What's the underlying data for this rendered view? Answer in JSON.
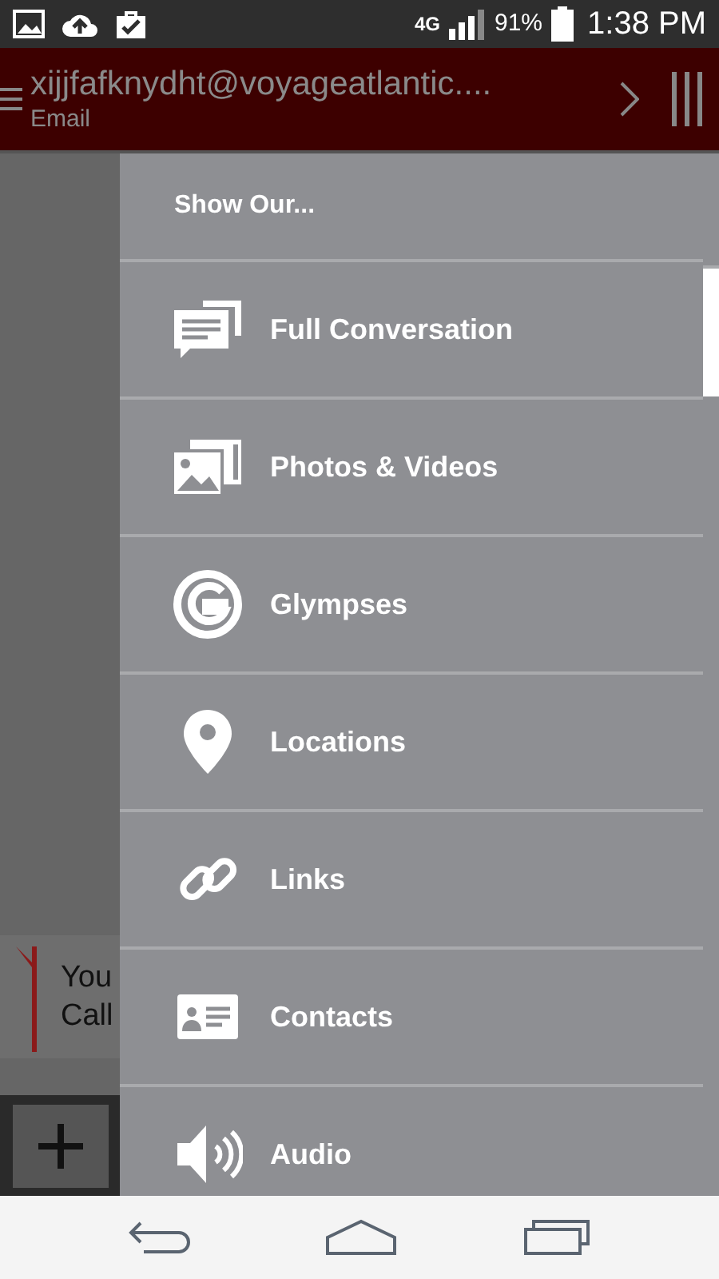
{
  "status_bar": {
    "battery": "91%",
    "time": "1:38 PM",
    "network": "4G"
  },
  "header": {
    "title": "xijjfafknydht@voyageatlantic....",
    "subtitle": "Email"
  },
  "background_card": {
    "lines": [
      "You",
      "Call"
    ]
  },
  "drawer": {
    "heading": "Show Our...",
    "items": [
      {
        "kind": "conversation",
        "label": "Full Conversation"
      },
      {
        "kind": "media",
        "label": "Photos & Videos"
      },
      {
        "kind": "glympse",
        "label": "Glympses"
      },
      {
        "kind": "location",
        "label": "Locations"
      },
      {
        "kind": "link",
        "label": "Links"
      },
      {
        "kind": "contact",
        "label": "Contacts"
      },
      {
        "kind": "audio",
        "label": "Audio"
      }
    ]
  }
}
